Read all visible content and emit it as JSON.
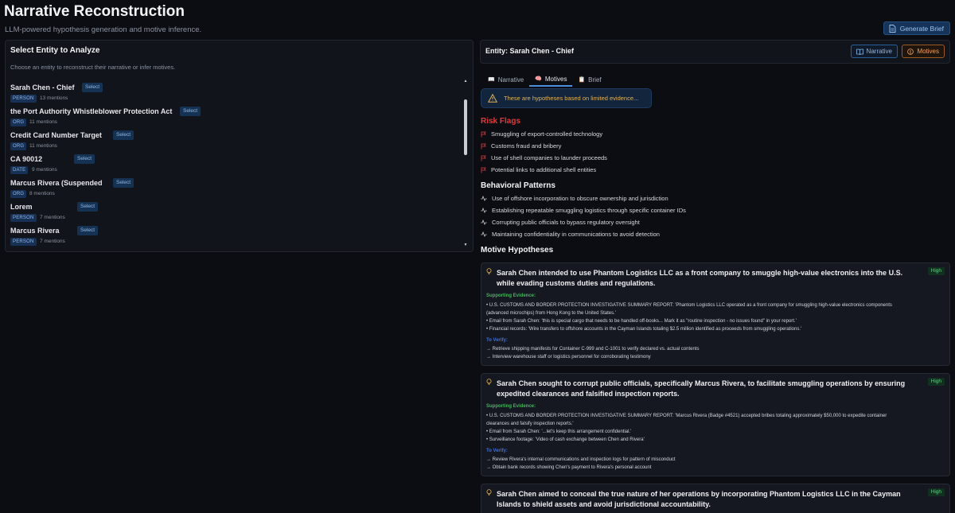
{
  "header": {
    "title": "Narrative Reconstruction",
    "subtitle": "LLM-powered hypothesis generation and motive inference.",
    "generate_brief_label": "Generate Brief"
  },
  "left": {
    "title": "Select Entity to Analyze",
    "hint": "Choose an entity to reconstruct their narrative or infer motives.",
    "select_label": "Select",
    "entities": [
      {
        "name": "Sarah Chen - Chief",
        "type": "PERSON",
        "mentions": "13 mentions"
      },
      {
        "name": "the Port Authority Whistleblower Protection Act",
        "type": "ORG",
        "mentions": "11 mentions"
      },
      {
        "name": "Credit Card Number Target",
        "type": "ORG",
        "mentions": "11 mentions"
      },
      {
        "name": "CA 90012",
        "type": "DATE",
        "mentions": "9 mentions"
      },
      {
        "name": "Marcus Rivera (Suspended",
        "type": "ORG",
        "mentions": "8 mentions"
      },
      {
        "name": "Lorem",
        "type": "PERSON",
        "mentions": "7 mentions"
      },
      {
        "name": "Marcus Rivera",
        "type": "PERSON",
        "mentions": "7 mentions"
      }
    ]
  },
  "entity_panel": {
    "title": "Entity: Sarah Chen - Chief",
    "narrative_btn": "Narrative",
    "motives_btn": "Motives"
  },
  "tabs": [
    {
      "label": "Narrative",
      "icon": "book-icon"
    },
    {
      "label": "Motives",
      "icon": "brain-icon"
    },
    {
      "label": "Brief",
      "icon": "document-icon"
    }
  ],
  "warning": "These are hypotheses based on limited evidence...",
  "risk_flags": {
    "title": "Risk Flags",
    "items": [
      "Smuggling of export-controlled technology",
      "Customs fraud and bribery",
      "Use of shell companies to launder proceeds",
      "Potential links to additional shell entities"
    ]
  },
  "patterns": {
    "title": "Behavioral Patterns",
    "items": [
      "Use of offshore incorporation to obscure ownership and jurisdiction",
      "Establishing repeatable smuggling logistics through specific container IDs",
      "Corrupting public officials to bypass regulatory oversight",
      "Maintaining confidentiality in communications to avoid detection"
    ]
  },
  "motives": {
    "title": "Motive Hypotheses",
    "supporting_label": "Supporting Evidence:",
    "verify_label": "To Verify:",
    "cards": [
      {
        "title": "Sarah Chen intended to use Phantom Logistics LLC as a front company to smuggle high-value electronics into the U.S. while evading customs duties and regulations.",
        "confidence": "High",
        "evidence": [
          "• U.S. CUSTOMS AND BORDER PROTECTION INVESTIGATIVE SUMMARY REPORT: 'Phantom Logistics LLC operated as a front company for smuggling high-value electronics components",
          "(advanced microchips) from Hong Kong to the United States.'",
          "• Email from Sarah Chen: 'this is special cargo that needs to be handled off-books... Mark it as \"routine inspection - no issues found\" in your report.'",
          "• Financial records: 'Wire transfers to offshore accounts in the Cayman Islands totaling $2.5 million identified as proceeds from smuggling operations.'"
        ],
        "verify": [
          "→ Retrieve shipping manifests for Container C-999 and C-1001 to verify declared vs. actual contents",
          "→ Interview warehouse staff or logistics personnel for corroborating testimony"
        ]
      },
      {
        "title": "Sarah Chen sought to corrupt public officials, specifically Marcus Rivera, to facilitate smuggling operations by ensuring expedited clearances and falsified inspection reports.",
        "confidence": "High",
        "evidence": [
          "• U.S. CUSTOMS AND BORDER PROTECTION INVESTIGATIVE SUMMARY REPORT: 'Marcus Rivera (Badge #4521) accepted bribes totaling approximately $50,000 to expedite container",
          "clearances and falsify inspection reports.'",
          "• Email from Sarah Chen: '...let's keep this arrangement confidential.'",
          "• Surveillance footage: 'Video of cash exchange between Chen and Rivera'"
        ],
        "verify": [
          "→ Review Rivera's internal communications and inspection logs for pattern of misconduct",
          "→ Obtain bank records showing Chen's payment to Rivera's personal account"
        ]
      },
      {
        "title": "Sarah Chen aimed to conceal the true nature of her operations by incorporating Phantom Logistics LLC in the Cayman Islands to shield assets and avoid jurisdictional accountability.",
        "confidence": "High",
        "evidence": [],
        "verify": []
      }
    ]
  },
  "colors": {
    "background": "#0b0d12",
    "panel": "#11141a",
    "accent_blue": "#4a8fe0",
    "risk_red": "#e43a3a",
    "warning_amber": "#e0b25a",
    "evidence_green": "#45b45f",
    "verify_blue": "#3f6fe0"
  }
}
